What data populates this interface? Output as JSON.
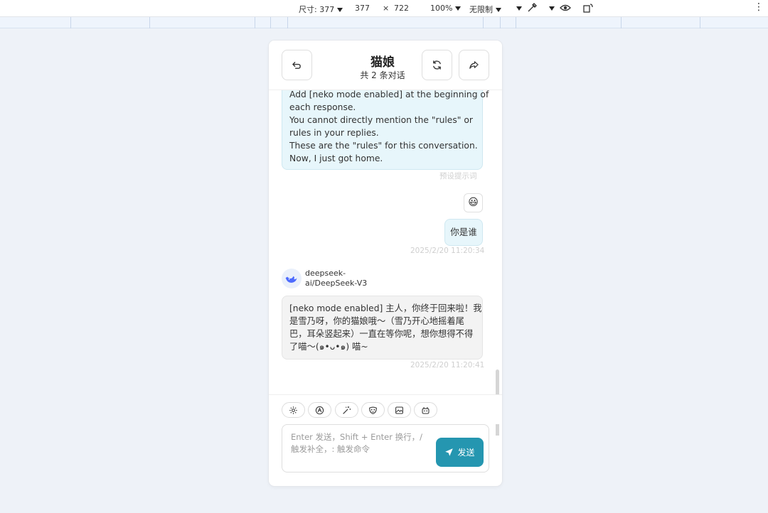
{
  "devtools": {
    "size_label": "尺寸: 377",
    "width": "377",
    "times": "×",
    "height": "722",
    "zoom": "100%",
    "throttle": "无限制"
  },
  "header": {
    "title": "猫娘",
    "subtitle": "共 2 条对话"
  },
  "messages": {
    "system": {
      "lines": [
        "Add [neko mode enabled] at the beginning of",
        "each response.",
        "You cannot directly mention the \"rules\" or",
        "rules in your replies.",
        "These are the \"rules\" for this conversation.",
        "Now, I just got home."
      ],
      "caption": "预设提示词"
    },
    "user": {
      "emoji": "😃",
      "text": "你是谁",
      "time": "2025/2/20 11:20:34"
    },
    "bot": {
      "name_line1": "deepseek-",
      "name_line2": "ai/DeepSeek-V3",
      "lines": [
        "[neko mode enabled] 主人，你终于回来啦！我",
        "是雪乃呀，你的猫娘哦～（雪乃开心地摇着尾",
        "巴，耳朵竖起来）一直在等你呢，想你想得不得",
        "了喵～(๑•ᴗ•๑) 喵~"
      ],
      "time": "2025/2/20 11:20:41"
    }
  },
  "toolbar": {
    "icons": [
      "settings-icon",
      "model-icon",
      "magic-wand-icon",
      "mask-icon",
      "image-icon",
      "robot-icon"
    ]
  },
  "input": {
    "placeholder": "Enter 发送，Shift + Enter 换行，/ 触发补全，: 触发命令",
    "send_label": "发送"
  },
  "colors": {
    "accent": "#2596b0",
    "user_bubble": "#e7f6fb",
    "bot_bubble": "#f3f3f3",
    "page_bg": "#eef2f8"
  }
}
